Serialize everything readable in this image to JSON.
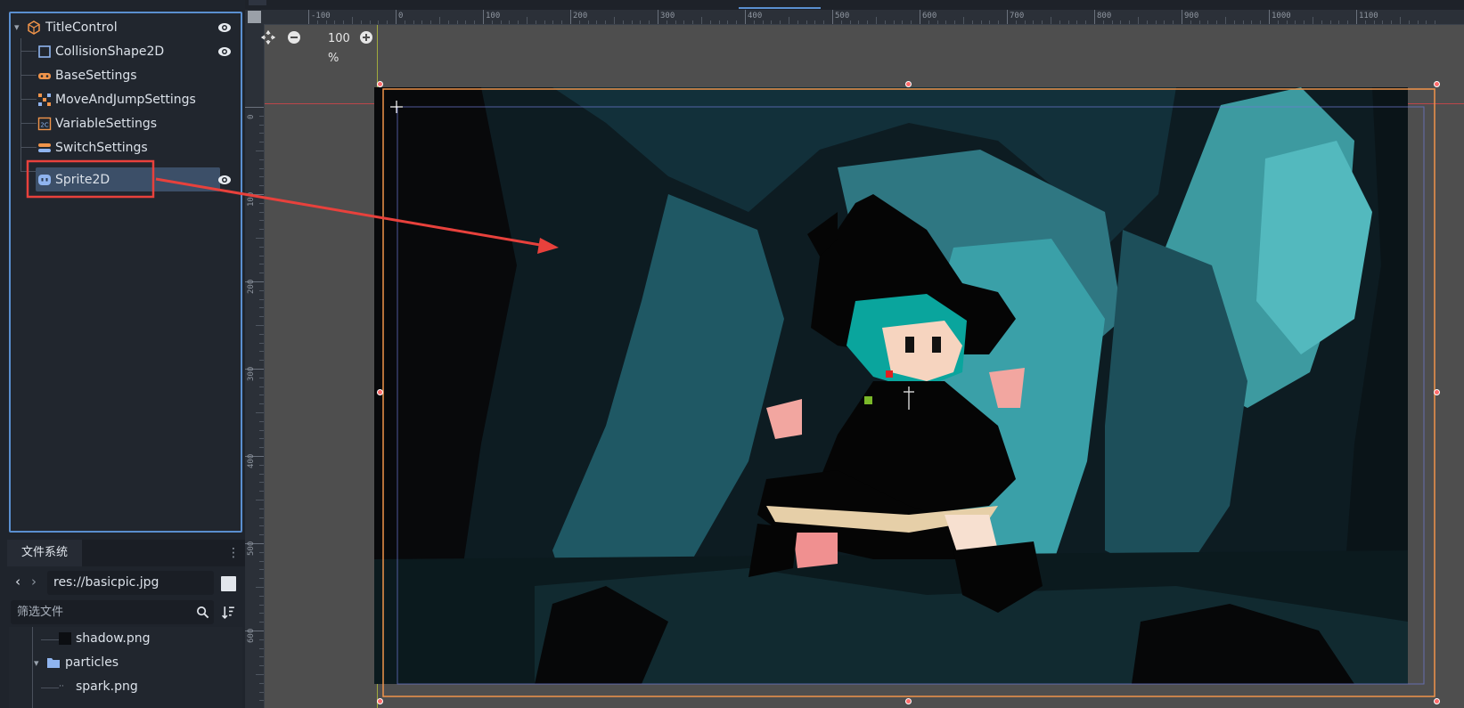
{
  "scene_tree": {
    "root": {
      "label": "TitleControl",
      "icon": "node-icon"
    },
    "children": [
      {
        "label": "CollisionShape2D",
        "icon": "collision-shape-icon",
        "visible_toggle": true
      },
      {
        "label": "BaseSettings",
        "icon": "gamepad-icon",
        "visible_toggle": false
      },
      {
        "label": "MoveAndJumpSettings",
        "icon": "move-icon",
        "visible_toggle": false
      },
      {
        "label": "VariableSettings",
        "icon": "variable-icon",
        "visible_toggle": false
      },
      {
        "label": "SwitchSettings",
        "icon": "switch-icon",
        "visible_toggle": false
      },
      {
        "label": "Sprite2D",
        "icon": "sprite-icon",
        "visible_toggle": true,
        "selected": true
      }
    ]
  },
  "filesystem": {
    "tab_label": "文件系统",
    "path": "res://basicpic.jpg",
    "filter_placeholder": "筛选文件",
    "items": [
      {
        "label": "shadow.png",
        "type": "file"
      },
      {
        "label": "particles",
        "type": "folder"
      },
      {
        "label": "spark.png",
        "type": "file"
      }
    ]
  },
  "viewport": {
    "zoom": "100 %",
    "ruler_top": [
      "-100",
      "0",
      "100",
      "200",
      "300",
      "400",
      "500",
      "600",
      "700",
      "800",
      "900",
      "1000",
      "1100"
    ],
    "ruler_left": [
      "0",
      "100",
      "200",
      "300",
      "400",
      "500",
      "600"
    ]
  },
  "colors": {
    "accent": "#5a8fd0",
    "selection": "#3c4f68",
    "annotation_red": "#e8413c",
    "sprite_border": "#f0944a",
    "handle": "#ff6b6b"
  }
}
